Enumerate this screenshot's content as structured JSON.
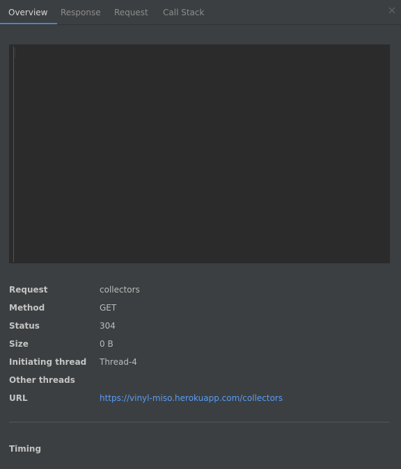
{
  "tabs": [
    {
      "label": "Overview",
      "active": true
    },
    {
      "label": "Response",
      "active": false
    },
    {
      "label": "Request",
      "active": false
    },
    {
      "label": "Call Stack",
      "active": false
    }
  ],
  "icons": {
    "close": "close-icon"
  },
  "colors": {
    "background": "#3c3f41",
    "editor_background": "#2b2b2b",
    "accent": "#4a88c7",
    "link": "#589df6"
  },
  "details": {
    "request": {
      "label": "Request",
      "value": "collectors"
    },
    "method": {
      "label": "Method",
      "value": "GET"
    },
    "status": {
      "label": "Status",
      "value": "304"
    },
    "size": {
      "label": "Size",
      "value": "0 B"
    },
    "initiating_thread": {
      "label": "Initiating thread",
      "value": "Thread-4"
    },
    "other_threads": {
      "label": "Other threads",
      "value": ""
    },
    "url": {
      "label": "URL",
      "value": "https://vinyl-miso.herokuapp.com/collectors"
    }
  },
  "timing": {
    "label": "Timing"
  }
}
